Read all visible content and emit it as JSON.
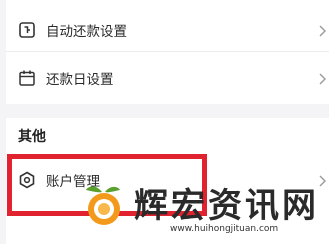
{
  "settings_group": {
    "items": [
      {
        "label": "自动还款设置",
        "icon": "auto-repay-icon"
      },
      {
        "label": "还款日设置",
        "icon": "calendar-icon"
      }
    ]
  },
  "other_group": {
    "title": "其他",
    "items": [
      {
        "label": "账户管理",
        "icon": "account-hexagon-icon"
      }
    ]
  },
  "colors": {
    "highlight": "#e0232f",
    "background": "#f4f4f6",
    "card": "#ffffff"
  },
  "watermark": {
    "brand": "辉宏资讯网",
    "url": "www.huihongjituan.com"
  }
}
